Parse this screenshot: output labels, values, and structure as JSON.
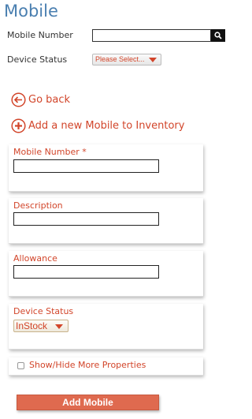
{
  "page": {
    "title": "Mobile"
  },
  "search": {
    "mobile_number_label": "Mobile Number",
    "mobile_number_value": "",
    "device_status_label": "Device Status",
    "device_status_value": "Please Select..."
  },
  "links": {
    "go_back": "Go back",
    "add_new": "Add a new Mobile to Inventory"
  },
  "form": {
    "mobile_number_label": "Mobile Number *",
    "mobile_number_value": "",
    "description_label": "Description",
    "description_value": "",
    "allowance_label": "Allowance",
    "allowance_value": "",
    "device_status_label": "Device Status",
    "device_status_value": "InStock",
    "show_hide_label": "Show/Hide More Properties",
    "show_hide_checked": false,
    "submit_label": "Add Mobile"
  },
  "colors": {
    "accent": "#d2452a",
    "title": "#4a7fb0",
    "button": "#df6a4f"
  },
  "icons": {
    "search": "search-icon",
    "go_back": "back-arrow-circle-icon",
    "add": "plus-circle-icon",
    "dropdown": "chevron-down-icon"
  }
}
